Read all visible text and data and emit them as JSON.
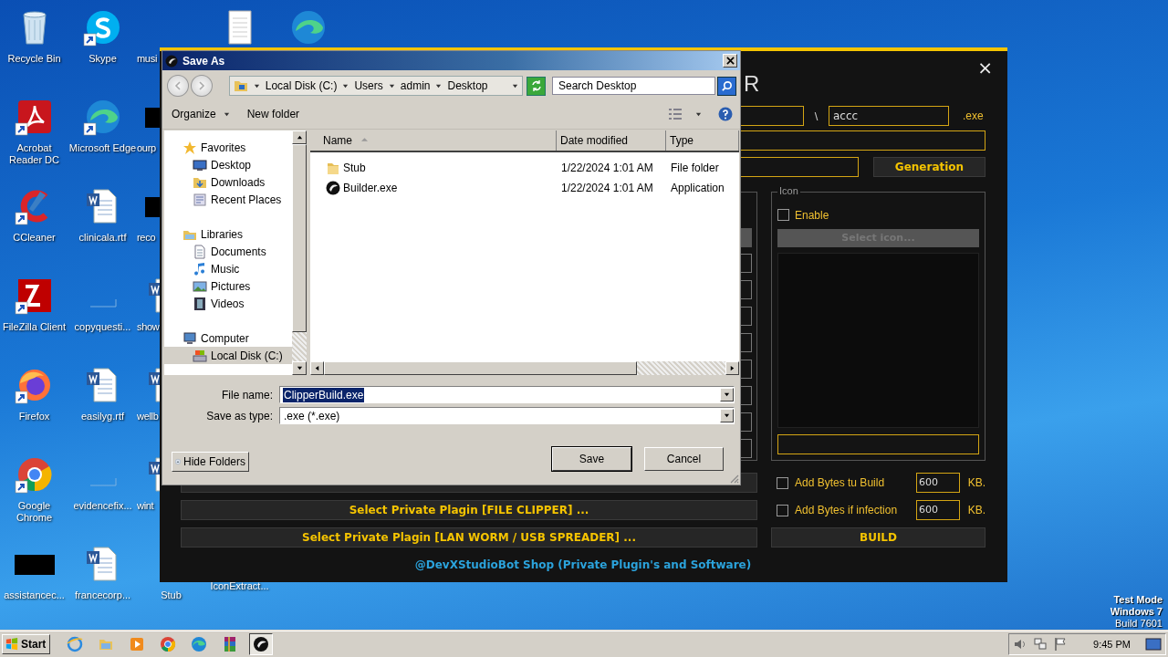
{
  "desktop": {
    "columns": [
      [
        {
          "label": "Recycle Bin",
          "kind": "recycle",
          "shortcut": false
        },
        {
          "label": "Acrobat Reader DC",
          "kind": "acrobat",
          "shortcut": true
        },
        {
          "label": "CCleaner",
          "kind": "ccleaner",
          "shortcut": true
        },
        {
          "label": "FileZilla Client",
          "kind": "filezilla",
          "shortcut": true
        },
        {
          "label": "Firefox",
          "kind": "firefox",
          "shortcut": true
        },
        {
          "label": "Google Chrome",
          "kind": "chrome",
          "shortcut": true
        },
        {
          "label": "assistancec...",
          "kind": "dark",
          "shortcut": false
        }
      ],
      [
        {
          "label": "Skype",
          "kind": "skype",
          "shortcut": true
        },
        {
          "label": "Microsoft Edge",
          "kind": "edge",
          "shortcut": true
        },
        {
          "label": "clinicala.rtf",
          "kind": "word",
          "shortcut": false
        },
        {
          "label": "copyquesti...",
          "kind": "blank",
          "shortcut": false
        },
        {
          "label": "easilyg.rtf",
          "kind": "word",
          "shortcut": false
        },
        {
          "label": "evidencefix...",
          "kind": "blank",
          "shortcut": false
        },
        {
          "label": "francecorp...",
          "kind": "word",
          "shortcut": false
        }
      ],
      [
        {
          "label": "musi"
        },
        {
          "label": "ourp",
          "kind": "dark",
          "shortcut": false
        },
        {
          "label": "reco",
          "kind": "dark",
          "shortcut": false
        },
        {
          "label": "show",
          "kind": "word",
          "shortcut": false
        },
        {
          "label": "wellb",
          "kind": "word",
          "shortcut": false
        },
        {
          "label": "wint",
          "kind": "word",
          "shortcut": false
        },
        {
          "label": "Stub"
        }
      ],
      [
        {
          "kind": "notepad",
          "shortcut": false
        },
        {
          "label": "IconExtract..."
        }
      ],
      [
        {
          "kind": "edge",
          "shortcut": false
        }
      ]
    ],
    "system_info": [
      "Test Mode",
      "Windows 7",
      "Build 7601"
    ]
  },
  "builder": {
    "title_fragment": "R",
    "close": "×",
    "separator": "\\",
    "name_value": "accc",
    "extension": ".exe",
    "generation_button": "Generation",
    "icon_group": {
      "legend": "Icon",
      "enable": {
        "label": "Enable",
        "checked": false
      },
      "select_button": {
        "label": "Select icon...",
        "disabled": true
      }
    },
    "plugin_buttons": [
      "Select Private Plagin [FILE CLIPPER] ...",
      "Select Private Plagin [LAN WORM / USB SPREADER] ..."
    ],
    "byte_options": [
      {
        "label": "Add Bytes tu Build",
        "checked": false,
        "value": "600",
        "unit": "KB."
      },
      {
        "label": "Add Bytes if infection",
        "checked": false,
        "value": "600",
        "unit": "KB."
      }
    ],
    "build_button": "BUILD",
    "shop_link": "@DevXStudioBot Shop (Private Plugin's and Software)"
  },
  "dialog": {
    "title": "Save As",
    "breadcrumb": [
      "Local Disk (C:)",
      "Users",
      "admin",
      "Desktop"
    ],
    "search": {
      "placeholder": "Search Desktop"
    },
    "organize": "Organize",
    "new_folder": "New folder",
    "nav": [
      {
        "label": "Favorites",
        "kind": "star",
        "selected": false,
        "children": [
          {
            "label": "Desktop",
            "kind": "desktop",
            "selected": false
          },
          {
            "label": "Downloads",
            "kind": "downloads",
            "selected": false
          },
          {
            "label": "Recent Places",
            "kind": "recent",
            "selected": false
          }
        ]
      },
      {
        "label": "Libraries",
        "kind": "library",
        "selected": false,
        "children": [
          {
            "label": "Documents",
            "kind": "documents",
            "selected": false
          },
          {
            "label": "Music",
            "kind": "music",
            "selected": false
          },
          {
            "label": "Pictures",
            "kind": "pictures",
            "selected": false
          },
          {
            "label": "Videos",
            "kind": "videos",
            "selected": false
          }
        ]
      },
      {
        "label": "Computer",
        "kind": "computer",
        "selected": false,
        "children": [
          {
            "label": "Local Disk (C:)",
            "kind": "disk",
            "selected": true
          }
        ]
      }
    ],
    "columns": [
      "Name",
      "Date modified",
      "Type"
    ],
    "files": [
      {
        "name": "Stub",
        "date": "1/22/2024 1:01 AM",
        "type": "File folder",
        "kind": "folder",
        "selected": false
      },
      {
        "name": "Builder.exe",
        "date": "1/22/2024 1:01 AM",
        "type": "Application",
        "kind": "app",
        "selected": false
      }
    ],
    "file_name": {
      "label": "File name:",
      "value": "ClipperBuild.exe",
      "text_selected": true
    },
    "save_type": {
      "label": "Save as type:",
      "value": ".exe (*.exe)"
    },
    "hide_folders": "Hide Folders",
    "save": "Save",
    "cancel": "Cancel"
  },
  "taskbar": {
    "start": "Start",
    "apps": [
      {
        "kind": "ie",
        "active": false
      },
      {
        "kind": "explorer",
        "active": false
      },
      {
        "kind": "media",
        "active": false
      },
      {
        "kind": "chrome",
        "active": false
      },
      {
        "kind": "edge",
        "active": false
      },
      {
        "kind": "winrar",
        "active": false
      },
      {
        "kind": "builder",
        "active": true
      }
    ],
    "clock": "9:45 PM"
  }
}
